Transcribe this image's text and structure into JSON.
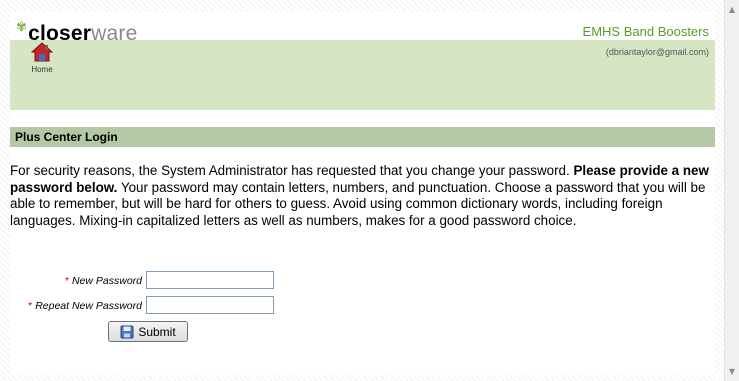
{
  "header": {
    "logo_bold": "closer",
    "logo_light": "ware",
    "organization": "EMHS Band Boosters",
    "home_label": "Home",
    "user_email": "(dbriantaylor@gmail.com)"
  },
  "section": {
    "title": "Plus Center Login"
  },
  "intro": {
    "text_before_bold": "For security reasons, the System Administrator has requested that you change your password. ",
    "bold_text": "Please provide a new password below.",
    "text_after_bold": " Your password may contain letters, numbers, and punctuation. Choose a password that you will be able to remember, but will be hard for others to guess. Avoid using common dictionary words, including foreign languages. Mixing-in capitalized letters as well as numbers, makes for a good password choice."
  },
  "form": {
    "required_mark": "*",
    "new_password_label": "New Password",
    "new_password_value": "",
    "repeat_password_label": "Repeat New Password",
    "repeat_password_value": "",
    "submit_label": "Submit"
  },
  "icons": {
    "home": "home-icon",
    "submit": "disk-icon",
    "logo_mark": "flower-icon"
  },
  "colors": {
    "header_bg": "#d6e6c4",
    "section_bg": "#b3c8a3",
    "org_text": "#5a9a28",
    "required": "#cc0000"
  }
}
